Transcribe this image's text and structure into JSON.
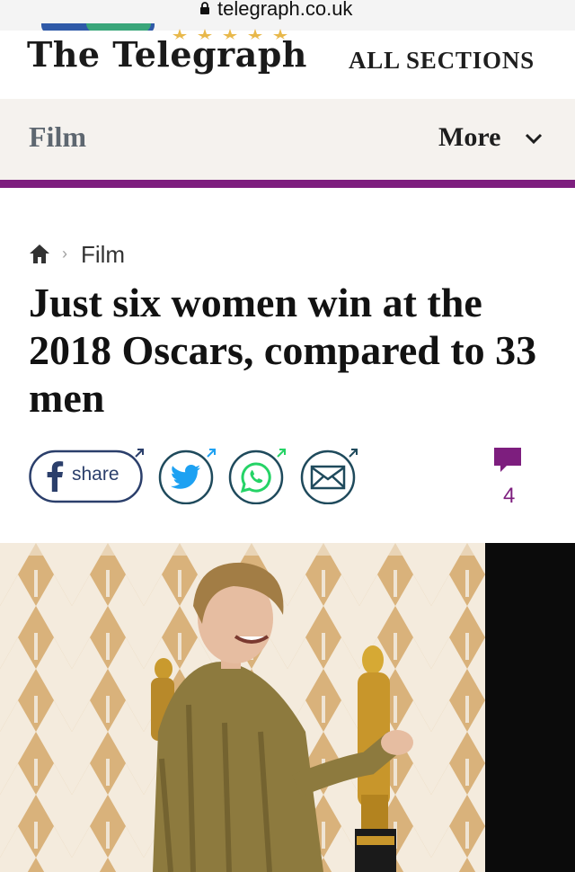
{
  "browser": {
    "url": "telegraph.co.uk"
  },
  "masthead": {
    "logo_text": "The Telegraph",
    "all_sections_label": "ALL SECTIONS"
  },
  "section_bar": {
    "section_label": "Film",
    "more_label": "More"
  },
  "breadcrumb": {
    "items": [
      "Film"
    ]
  },
  "article": {
    "headline": "Just six women win at the 2018 Oscars, compared to 33 men",
    "comment_count": "4"
  },
  "share": {
    "facebook_label": "share"
  },
  "icons": [
    "lock-icon",
    "home-icon",
    "chevron-down-icon",
    "facebook-icon",
    "twitter-icon",
    "whatsapp-icon",
    "email-icon",
    "comment-icon",
    "external-arrow-icon"
  ],
  "colors": {
    "accent_purple": "#7d1e7e",
    "section_bar_bg": "#f5f2ee",
    "share_blue": "#2b3f6b",
    "twitter_blue": "#1da1f2",
    "whatsapp_green": "#25d366",
    "email_navy": "#1f4a5c"
  }
}
